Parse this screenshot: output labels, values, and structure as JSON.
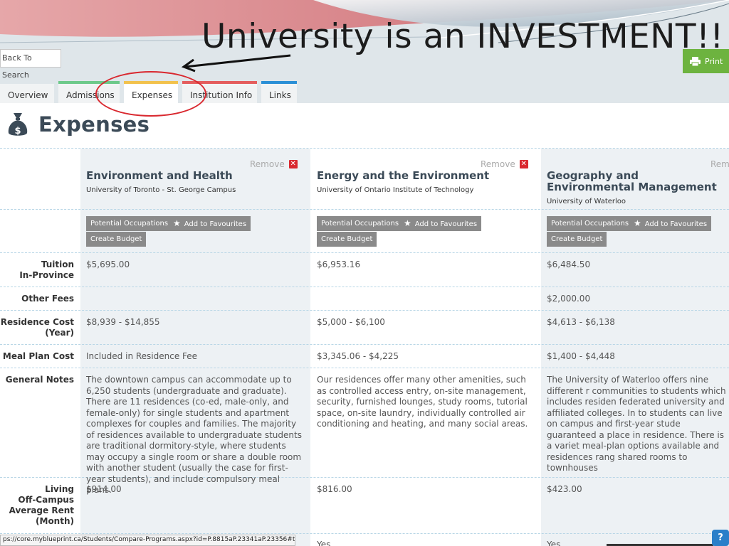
{
  "slide": {
    "title": "University is an INVESTMENT!!"
  },
  "toolbar": {
    "back_label": "Back To Search",
    "print_label": "Print"
  },
  "tabs": [
    {
      "label": "Overview"
    },
    {
      "label": "Admissions"
    },
    {
      "label": "Expenses"
    },
    {
      "label": "Institution Info"
    },
    {
      "label": "Links"
    }
  ],
  "page": {
    "heading": "Expenses",
    "icon": "money-bag-icon"
  },
  "actions": {
    "remove_label": "Remove",
    "potential_occupations": "Potential Occupations",
    "add_favourites": "Add to Favourites",
    "create_budget": "Create Budget"
  },
  "row_labels": {
    "tuition": "Tuition\nIn-Province",
    "other_fees": "Other Fees",
    "residence": "Residence Cost\n(Year)",
    "meal_plan": "Meal Plan Cost",
    "general_notes": "General Notes",
    "living": "Living\nOff-Campus\nAverage Rent\n(Month)"
  },
  "programs": [
    {
      "title": "Environment and Health",
      "institution": "University of Toronto - St. George Campus",
      "tuition": "$5,695.00",
      "other_fees": "",
      "residence": "$8,939 - $14,855",
      "meal_plan": "Included in Residence Fee",
      "general_notes": "The downtown campus can accommodate up to 6,250 students (undergraduate and graduate). There are 11 residences (co-ed, male-only, and female-only) for single students and apartment complexes for couples and families. The majority of residences available to undergraduate students are traditional dormitory-style, where students may occupy a single room or share a double room with another student (usually the case for first-year students), and include compulsory meal plans.",
      "living": "$914.00",
      "next": ""
    },
    {
      "title": "Energy and the Environment",
      "institution": "University of Ontario Institute of Technology",
      "tuition": "$6,953.16",
      "other_fees": "",
      "residence": "$5,000 - $6,100",
      "meal_plan": "$3,345.06 - $4,225",
      "general_notes": "Our residences offer many other amenities, such as controlled access entry, on-site management, security, furnished lounges, study rooms, tutorial space, on-site laundry, individually controlled air conditioning and heating, and many social areas.",
      "living": "$816.00",
      "next": "Yes"
    },
    {
      "title": "Geography and Environmental Management",
      "institution": "University of Waterloo",
      "tuition": "$6,484.50",
      "other_fees": "$2,000.00",
      "residence": "$4,613 - $6,138",
      "meal_plan": "$1,400 - $4,448",
      "general_notes": "The University of Waterloo offers nine different r communities to students which includes residen federated university and affiliated colleges. In to students can live on campus and first-year stude guaranteed a place in residence. There is a variet meal-plan options available and residences rang shared rooms to townhouses",
      "living": "$423.00",
      "next": "Yes"
    }
  ],
  "status_bar": {
    "url": "ps://core.myblueprint.ca/Students/Compare-Programs.aspx?id=P.8815aP.23341aP.23356#tabs-34"
  },
  "help": {
    "label": "?"
  },
  "colors": {
    "accent_green": "#6db33f",
    "annotation_red": "#d9282f",
    "heading": "#3b4a57"
  }
}
